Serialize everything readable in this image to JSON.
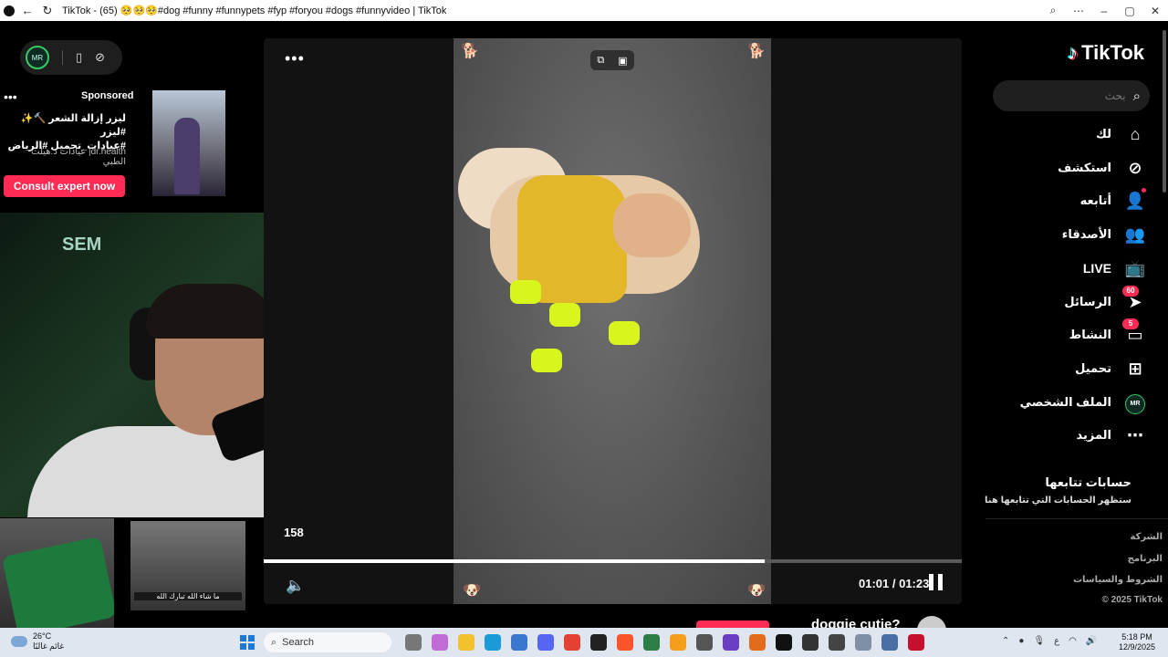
{
  "browser": {
    "title": "TikTok - (65) 🥺🥺🥺#dog #funny #funnypets #fyp #foryou #dogs #funnyvideo | TikTok"
  },
  "stream": {
    "pill_avatar": "MR",
    "viewer_count": "158",
    "webcam_logo": "SEM",
    "gift_caption": "ما شاء الله تبارك الله"
  },
  "ad": {
    "sponsored": "Sponsored",
    "text_line1": "ليزر إزالة الشعر 🔨✨ #ليزر",
    "text_line2": "#عيادات_تجميل #الرياض",
    "advertiser": "dr.health| عيادات د.هيلث الطبي",
    "cta": "Consult expert now"
  },
  "player": {
    "time": "01:01 / 01:23",
    "progress": 0.718,
    "video_title": "doggie cutie?"
  },
  "sidebar": {
    "brand": "TikTok",
    "search_placeholder": "بحث",
    "nav": [
      {
        "label": "لك",
        "icon": "home-icon"
      },
      {
        "label": "استكشف",
        "icon": "compass-icon"
      },
      {
        "label": "أتابعه",
        "icon": "following-icon"
      },
      {
        "label": "الأصدقاء",
        "icon": "friends-icon"
      },
      {
        "label": "LIVE",
        "icon": "live-icon"
      },
      {
        "label": "الرسائل",
        "icon": "messages-icon",
        "badge": "60"
      },
      {
        "label": "النشاط",
        "icon": "activity-icon",
        "badge": "5"
      },
      {
        "label": "تحميل",
        "icon": "upload-icon"
      },
      {
        "label": "الملف الشخصي",
        "icon": "profile-avatar",
        "avatar": "MR"
      },
      {
        "label": "المزيد",
        "icon": "more-icon"
      }
    ],
    "following_heading": "حسابات تتابعها",
    "following_sub": "ستظهر الحسابات التي تتابعها هنا",
    "footer": [
      "الشركة",
      "البرنامج",
      "الشروط والسياسات",
      "© 2025 TikTok"
    ]
  },
  "taskbar": {
    "weather_temp": "26°C",
    "weather_desc": "غائم غالبًا",
    "search_label": "Search",
    "lang": "ع",
    "time": "5:18 PM",
    "date": "12/9/2025"
  },
  "colors": {
    "accent": "#fe2c55",
    "background": "#000000",
    "card": "#121212"
  }
}
